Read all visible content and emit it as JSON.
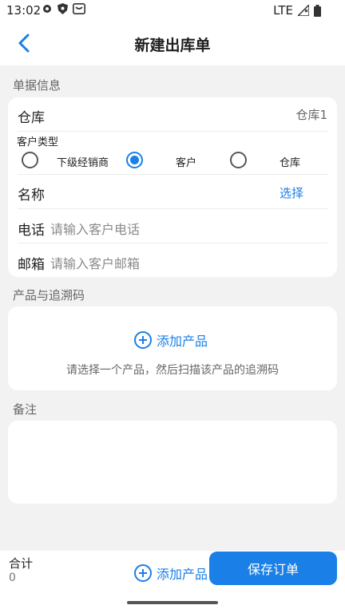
{
  "status": {
    "time": "13:02",
    "network": "LTE"
  },
  "header": {
    "title": "新建出库单"
  },
  "doc_section": {
    "label": "单据信息",
    "warehouse_label": "仓库",
    "warehouse_value": "仓库1",
    "customer_type_label": "客户类型",
    "customer_type_options": [
      {
        "label": "下级经销商",
        "selected": false
      },
      {
        "label": "客户",
        "selected": true
      },
      {
        "label": "仓库",
        "selected": false
      }
    ],
    "name_label": "名称",
    "name_action": "选择",
    "phone_label": "电话",
    "phone_placeholder": "请输入客户电话",
    "email_label": "邮箱",
    "email_placeholder": "请输入客户邮箱"
  },
  "product_section": {
    "label": "产品与追溯码",
    "add_label": "添加产品",
    "hint": "请选择一个产品，然后扫描该产品的追溯码"
  },
  "remark_section": {
    "label": "备注"
  },
  "footer": {
    "total_label": "合计",
    "total_value": "0",
    "add_label": "添加产品",
    "save_label": "保存订单"
  },
  "colors": {
    "accent": "#1a7fe6",
    "background": "#f2f2f3"
  }
}
